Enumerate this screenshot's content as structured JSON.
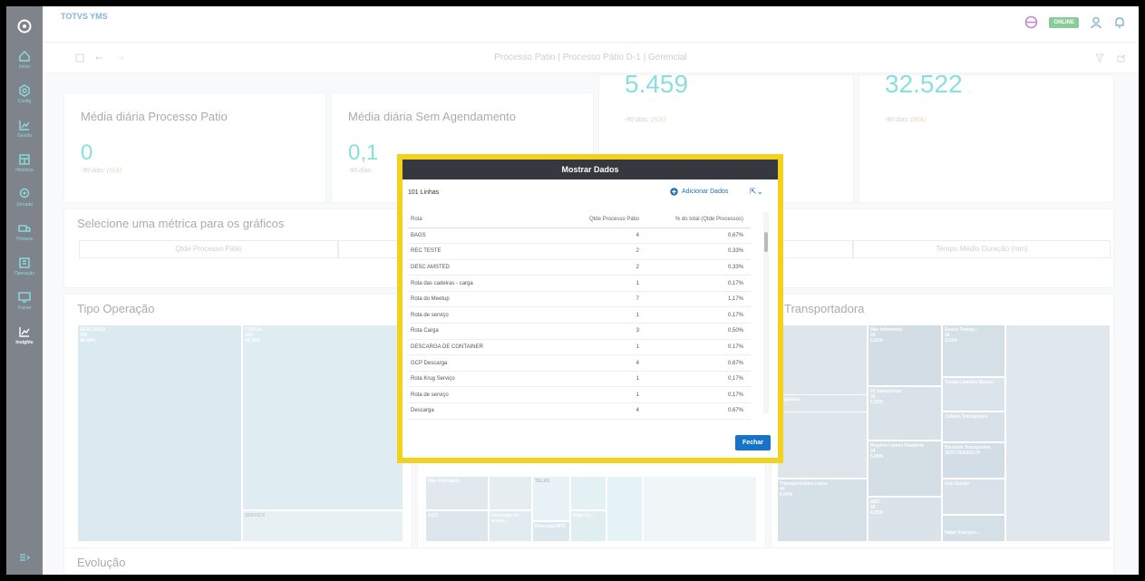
{
  "topbar": {
    "app_title": "TOTVS YMS",
    "status_badge": "ONLINE"
  },
  "subbar": {
    "title": "Processo Patio | Processo Pátio D-1 | Gerencial"
  },
  "sidebar": {
    "items": [
      {
        "label": "Início",
        "icon": "home-icon"
      },
      {
        "label": "Config",
        "icon": "gear-icon"
      },
      {
        "label": "Gestão",
        "icon": "chart-icon"
      },
      {
        "label": "Histórico",
        "icon": "history-icon"
      },
      {
        "label": "Jornada",
        "icon": "location-icon"
      },
      {
        "label": "Portaria",
        "icon": "truck-icon"
      },
      {
        "label": "Operação",
        "icon": "building-icon"
      },
      {
        "label": "Painel",
        "icon": "monitor-icon"
      },
      {
        "label": "Insights",
        "icon": "insights-icon"
      }
    ]
  },
  "kpis": [
    {
      "label": "Média diária Processo Patio",
      "value": "0",
      "sub": "-90 dias:",
      "sub_val": "(N/A)"
    },
    {
      "label": "Média diária Sem Agendamento",
      "value": "0,1",
      "sub": "-90 dias:",
      "sub_val": ""
    },
    {
      "label": "",
      "value": "5.459",
      "sub": "-90 dias:",
      "sub_val": "(N/A)"
    },
    {
      "label": "",
      "value": "32.522",
      "sub": "-90 dias:",
      "sub_val": "(N/A)"
    }
  ],
  "metrics": {
    "title": "Selecione uma métrica para os gráficos",
    "tabs": [
      "Qtde Processo Pátio",
      "Tempo Médio Duração (min)"
    ]
  },
  "tipo_operacao": {
    "title": "Tipo Operação",
    "cells": [
      {
        "name": "DESCARGA",
        "count": "290",
        "pct": "48,49%"
      },
      {
        "name": "CARGA",
        "count": "264",
        "pct": "44,15%"
      },
      {
        "name": "SERVIÇO",
        "count": "",
        "pct": ""
      }
    ]
  },
  "rota_treemap": {
    "labels": [
      "Não Informado",
      "AÇO",
      "Descarga ne armaz...",
      "Descarga M76",
      "TELAS",
      "Rota Ca..."
    ]
  },
  "transportadora": {
    "title": "Transportadora",
    "cells": [
      {
        "name": "Não Informado",
        "count": "39",
        "pct": "6,52%"
      },
      {
        "name": "Souza Transp...",
        "count": "18",
        "pct": "3,01%"
      },
      {
        "name": "22 transportes",
        "count": "38",
        "pct": "6,35%"
      },
      {
        "name": "Tramp Leandro Morais",
        "count": "",
        "pct": ""
      },
      {
        "name": "Juliano Transportes",
        "count": "",
        "pct": ""
      },
      {
        "name": "Bisclash Transportes",
        "count": "",
        "pct": ""
      },
      {
        "name": "36757362000179",
        "count": "",
        "pct": ""
      },
      {
        "name": "Rogério Lemes Prudente",
        "count": "34",
        "pct": "5,69%"
      },
      {
        "name": "Ana Zander",
        "count": "",
        "pct": ""
      },
      {
        "name": "ABC",
        "count": "26",
        "pct": "4,35%"
      },
      {
        "name": "Transportadora Lopes",
        "count": "40",
        "pct": "6,69%"
      },
      {
        "name": "Natal Transpor...",
        "count": "",
        "pct": ""
      },
      {
        "name": "Logística",
        "count": "",
        "pct": ""
      }
    ]
  },
  "evolucao": {
    "title": "Evolução"
  },
  "modal": {
    "title": "Mostrar Dados",
    "rows_label": "101 Linhas",
    "add_label": "Adicionar Dados",
    "close_label": "Fechar",
    "columns": [
      "Rota",
      "Qtde Processo Pátio",
      "% do total (Qtde Processos)"
    ],
    "rows": [
      [
        "BAGS",
        "4",
        "0,67%"
      ],
      [
        "REC TESTE",
        "2",
        "0,33%"
      ],
      [
        "DESC AMSTED",
        "2",
        "0,33%"
      ],
      [
        "Rota das cadeiras - carga",
        "1",
        "0,17%"
      ],
      [
        "Rota do Meetup",
        "7",
        "1,17%"
      ],
      [
        "Rota de serviço",
        "1",
        "0,17%"
      ],
      [
        "Rota Carga",
        "3",
        "0,50%"
      ],
      [
        "DESCARGA DE CONTAINER",
        "1",
        "0,17%"
      ],
      [
        "GCP Descarga",
        "4",
        "0,67%"
      ],
      [
        "Rota Krug Serviço",
        "1",
        "0,17%"
      ],
      [
        "Rota de serviço",
        "1",
        "0,17%"
      ],
      [
        "Descarga",
        "4",
        "0,67%"
      ]
    ]
  }
}
